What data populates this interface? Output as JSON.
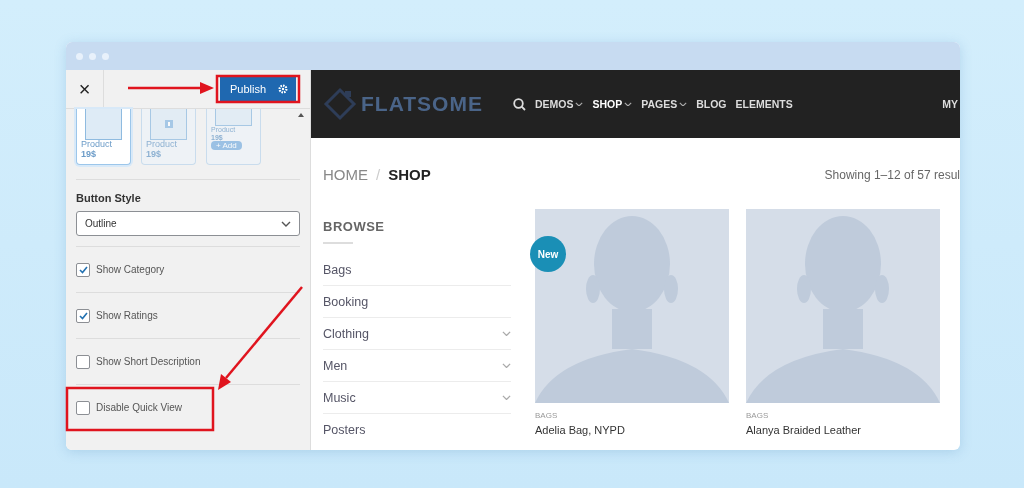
{
  "customizer": {
    "close": "×",
    "publish": "Publish",
    "layouts": [
      {
        "title": "Product",
        "price": "19$",
        "selected": true,
        "kind": "plain"
      },
      {
        "title": "Product",
        "price": "19$",
        "selected": false,
        "kind": "icon"
      },
      {
        "title": "Product",
        "price": "19$",
        "add": "+ Add",
        "selected": false,
        "kind": "add"
      }
    ],
    "button_style": {
      "label": "Button Style",
      "value": "Outline"
    },
    "options": [
      {
        "label": "Show Category",
        "checked": true
      },
      {
        "label": "Show Ratings",
        "checked": true
      },
      {
        "label": "Show Short Description",
        "checked": false
      },
      {
        "label": "Disable Quick View",
        "checked": false
      }
    ]
  },
  "site": {
    "logo": "FLATSOME",
    "nav": [
      {
        "label": "DEMOS",
        "dropdown": true,
        "selected": false
      },
      {
        "label": "SHOP",
        "dropdown": true,
        "selected": true
      },
      {
        "label": "PAGES",
        "dropdown": true,
        "selected": false
      },
      {
        "label": "BLOG",
        "dropdown": false,
        "selected": false
      },
      {
        "label": "ELEMENTS",
        "dropdown": false,
        "selected": false
      }
    ],
    "nav_right": "MY",
    "breadcrumb": [
      {
        "label": "HOME",
        "selected": false
      },
      {
        "label": "SHOP",
        "selected": true
      }
    ],
    "breadcrumb_separator": "/",
    "result_count": "Showing 1–12 of 57 resul",
    "browse": {
      "title": "BROWSE",
      "categories": [
        {
          "label": "Bags",
          "expandable": false
        },
        {
          "label": "Booking",
          "expandable": false
        },
        {
          "label": "Clothing",
          "expandable": true
        },
        {
          "label": "Men",
          "expandable": true
        },
        {
          "label": "Music",
          "expandable": true
        },
        {
          "label": "Posters",
          "expandable": false
        }
      ]
    },
    "products": [
      {
        "badge": "New",
        "category": "BAGS",
        "name": "Adelia Bag, NYPD"
      },
      {
        "category": "BAGS",
        "name": "Alanya Braided Leather"
      }
    ]
  }
}
